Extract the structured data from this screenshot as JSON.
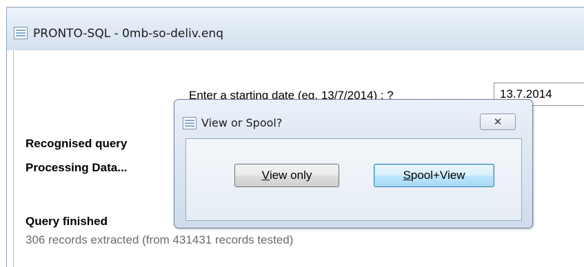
{
  "main_window": {
    "title": "PRONTO-SQL - 0mb-so-deliv.enq",
    "icon": "app-window-icon"
  },
  "prompt": {
    "label": "Enter a starting date (eg. 13/7/2014) : ?",
    "value": "13.7.2014"
  },
  "status": {
    "recognised": "Recognised query",
    "processing": "Processing Data...",
    "finished": "Query finished",
    "records": "306 records extracted (from 431431 records tested)"
  },
  "dialog": {
    "title": "View or Spool?",
    "close_icon": "close-x-icon",
    "view_only": {
      "mnemonic": "V",
      "rest": "iew only"
    },
    "spool_view": {
      "mnemonic": "S",
      "rest": "pool+View"
    }
  }
}
